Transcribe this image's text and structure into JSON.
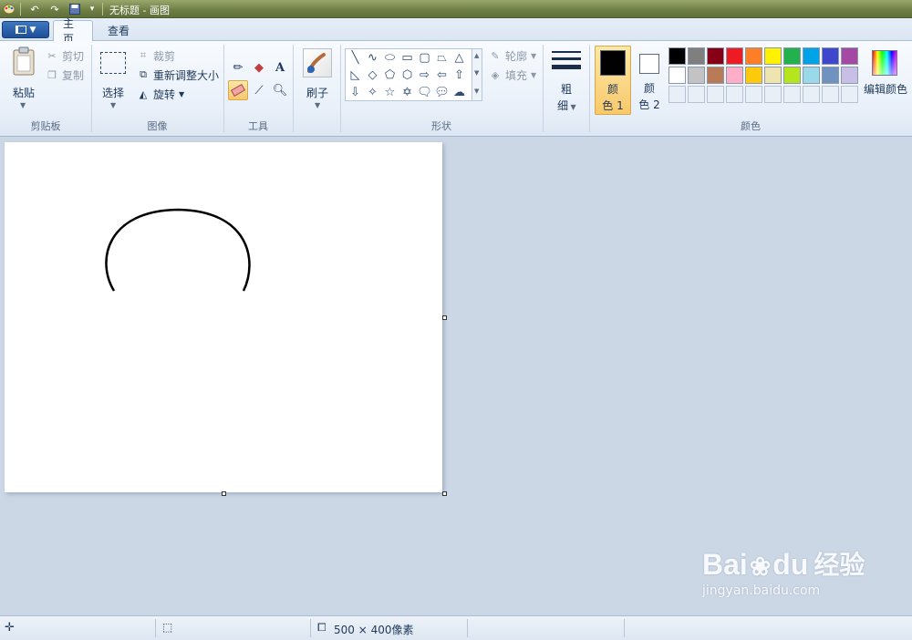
{
  "window": {
    "title": "无标题 - 画图"
  },
  "tabs": {
    "file_icon": "menu-icon",
    "home": "主页",
    "view": "查看"
  },
  "clipboard": {
    "paste": "粘贴",
    "cut": "剪切",
    "copy": "复制",
    "label": "剪贴板"
  },
  "image": {
    "select": "选择",
    "crop": "裁剪",
    "resize": "重新调整大小",
    "rotate": "旋转",
    "label": "图像"
  },
  "tools": {
    "label": "工具",
    "text_glyph": "A"
  },
  "brushes": {
    "label": "刷子"
  },
  "shapes": {
    "outline": "轮廓",
    "fill": "填充",
    "label": "形状"
  },
  "size": {
    "label1": "粗",
    "label2": "细"
  },
  "colors": {
    "color1_a": "颜",
    "color1_b": "色 1",
    "color2_a": "颜",
    "color2_b": "色 2",
    "edit": "编辑颜色",
    "label": "颜色",
    "color1_value": "#000000",
    "color2_value": "#ffffff",
    "palette_row1": [
      "#000000",
      "#7f7f7f",
      "#880015",
      "#ed1c24",
      "#ff7f27",
      "#fff200",
      "#22b14c",
      "#00a2e8",
      "#3f48cc",
      "#a349a4"
    ],
    "palette_row2": [
      "#ffffff",
      "#c3c3c3",
      "#b97a57",
      "#ffaec9",
      "#ffc90e",
      "#efe4b0",
      "#b5e61d",
      "#99d9ea",
      "#7092be",
      "#c8bfe7"
    ]
  },
  "status": {
    "canvas_size": "500 × 400像素"
  },
  "watermark": {
    "brand": "Bai",
    "brand2": "du",
    "cn": "经验",
    "url": "jingyan.baidu.com"
  }
}
